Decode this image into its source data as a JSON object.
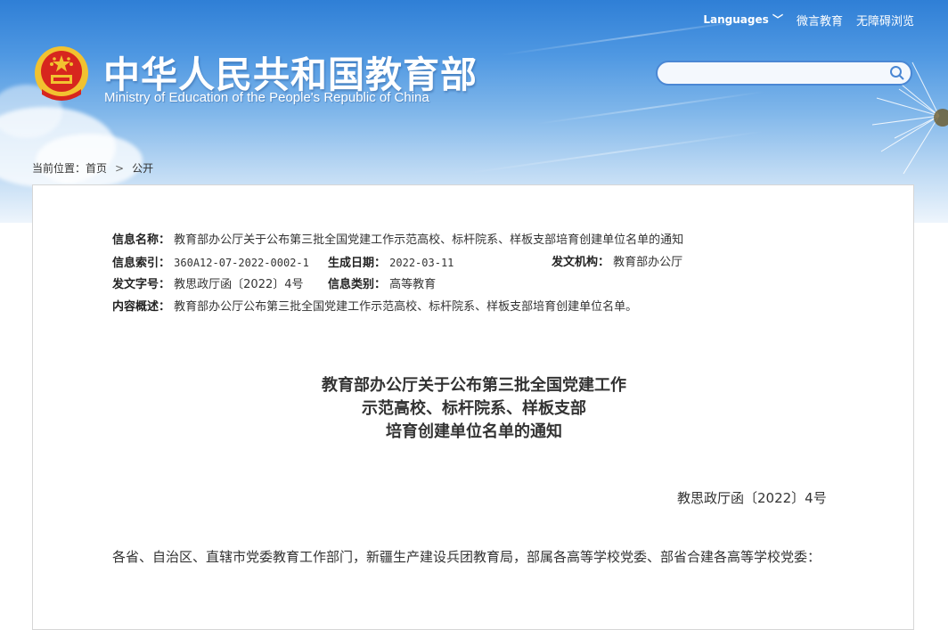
{
  "header": {
    "language_label": "Languages",
    "weibo_label": "微言教育",
    "accessibility_label": "无障碍浏览",
    "site_title": "中华人民共和国教育部",
    "site_subtitle": "Ministry of Education of the People's Republic of China",
    "search_placeholder": ""
  },
  "breadcrumb": {
    "prefix": "当前位置：",
    "home": "首页",
    "current": "公开"
  },
  "meta": {
    "name_label": "信息名称：",
    "name_value": "教育部办公厅关于公布第三批全国党建工作示范高校、标杆院系、样板支部培育创建单位名单的通知",
    "index_label": "信息索引：",
    "index_value": "360A12-07-2022-0002-1",
    "date_label": "生成日期：",
    "date_value": "2022-03-11",
    "issuer_label": "发文机构：",
    "issuer_value": "教育部办公厅",
    "docno_label": "发文字号：",
    "docno_value": "教思政厅函〔2022〕4号",
    "category_label": "信息类别：",
    "category_value": "高等教育",
    "summary_label": "内容概述：",
    "summary_value": "教育部办公厅公布第三批全国党建工作示范高校、标杆院系、样板支部培育创建单位名单。"
  },
  "document": {
    "title_line1": "教育部办公厅关于公布第三批全国党建工作",
    "title_line2": "示范高校、标杆院系、样板支部",
    "title_line3": "培育创建单位名单的通知",
    "number": "教思政厅函〔2022〕4号",
    "addressee": "各省、自治区、直辖市党委教育工作部门，新疆生产建设兵团教育局，部属各高等学校党委、部省合建各高等学校党委："
  },
  "colors": {
    "banner_top": "#2f7fd6",
    "emblem_red": "#d7261e",
    "emblem_gold": "#f2c230",
    "search_border": "#4a87d4"
  }
}
